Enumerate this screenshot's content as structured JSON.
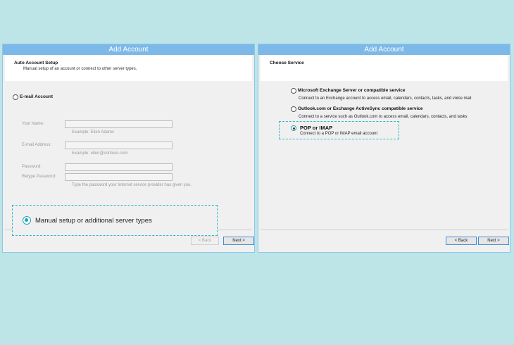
{
  "left": {
    "title": "Add Account",
    "header_title": "Auto Account Setup",
    "header_subtitle": "Manual setup of an account or connect to other server types.",
    "email_option": "E-mail Account",
    "your_name_label": "Your Name:",
    "your_name_hint": "Example: Ellen Adams",
    "email_label": "E-mail Address:",
    "email_hint": "Example: ellen@contoso.com",
    "password_label": "Password:",
    "retype_label": "Retype Password:",
    "password_hint": "Type the password your Internet service provider has given you.",
    "manual_option": "Manual setup or additional server types",
    "back_button": "< Back",
    "next_button": "Next >"
  },
  "right": {
    "title": "Add Account",
    "header_title": "Choose Service",
    "exchange_title": "Microsoft Exchange Server or compatible service",
    "exchange_desc": "Connect to an Exchange account to access email, calendars, contacts, tasks, and voice mail",
    "outlook_title": "Outlook.com or Exchange ActiveSync compatible service",
    "outlook_desc": "Connect to a service such as Outlook.com to access email, calendars, contacts, and tasks",
    "pop_title": "POP or IMAP",
    "pop_desc": "Connect to a POP or IMAP email account",
    "back_button": "< Back",
    "next_button": "Next >"
  },
  "colors": {
    "background": "#bde5e8",
    "titlebar": "#7db9e8",
    "callout": "#2fb6c8"
  }
}
